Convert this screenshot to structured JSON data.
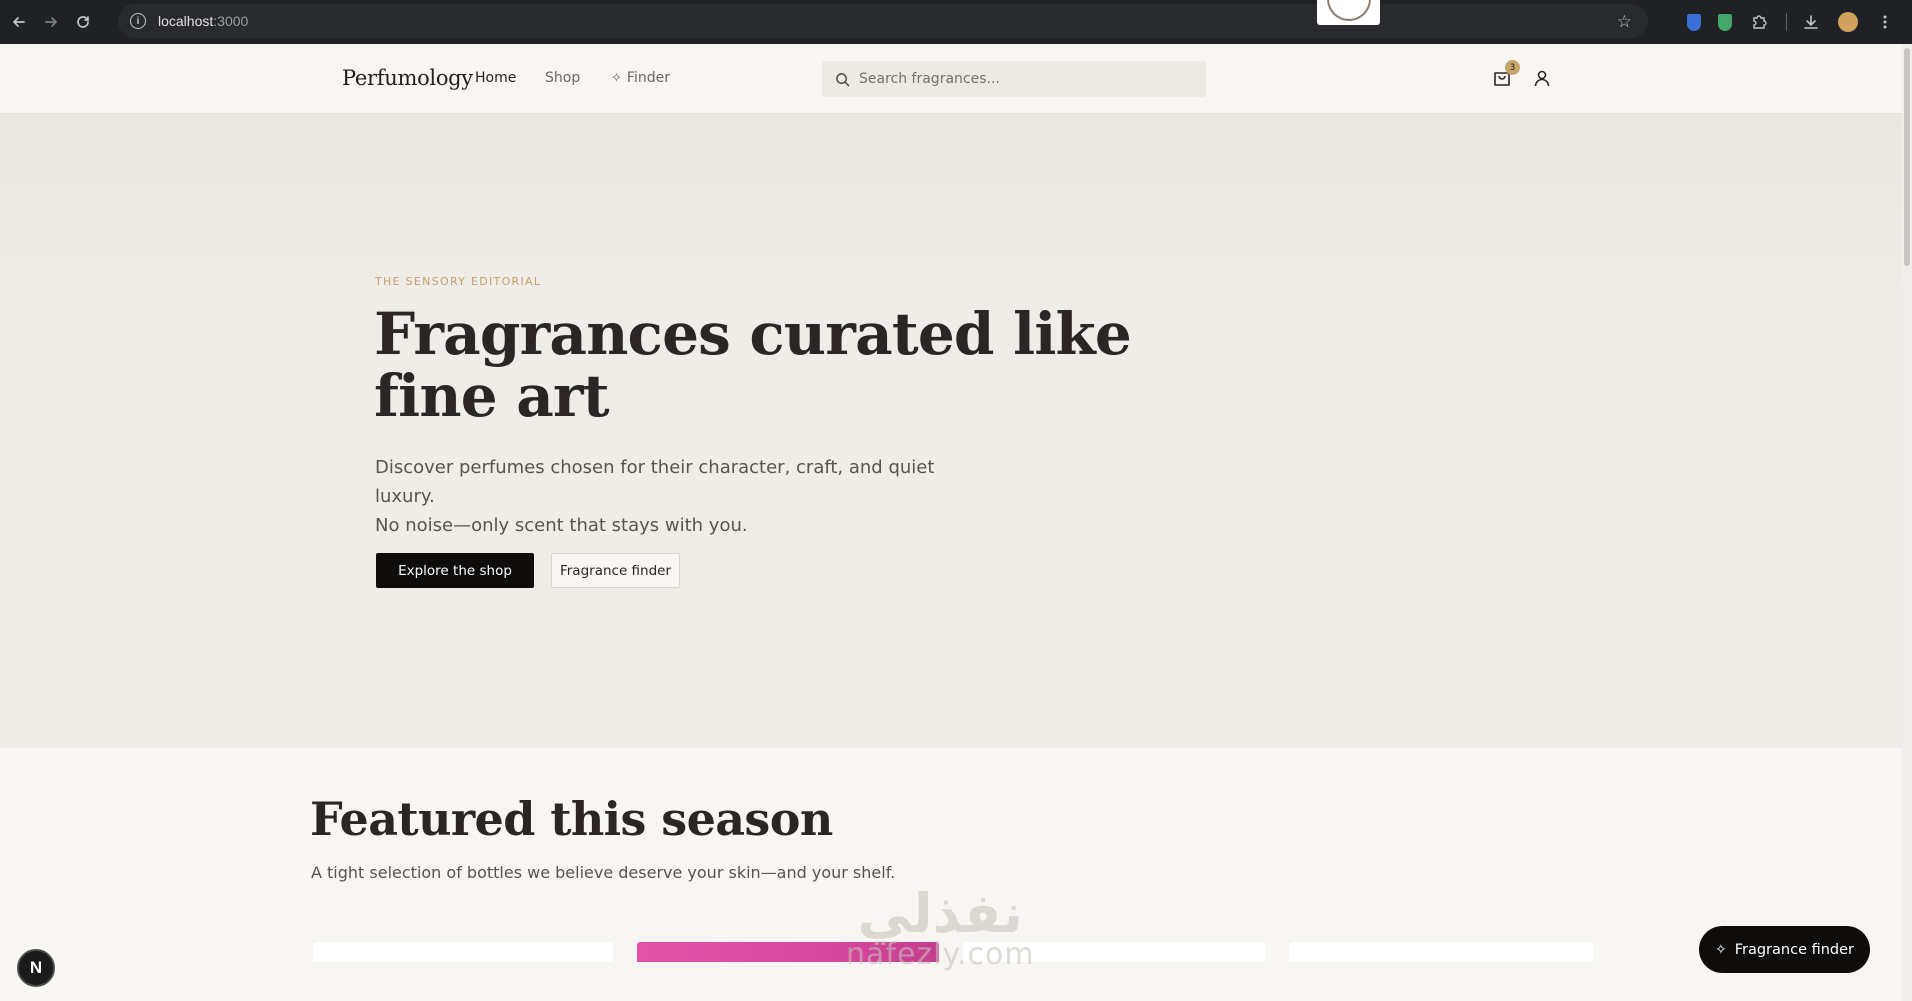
{
  "browser": {
    "url_host": "localhost",
    "url_port": ":3000"
  },
  "header": {
    "logo": "Perfumology",
    "nav": {
      "home": "Home",
      "shop": "Shop",
      "finder": "Finder"
    },
    "search_placeholder": "Search fragrances...",
    "cart_count": "3"
  },
  "hero": {
    "eyebrow": "THE SENSORY EDITORIAL",
    "title": "Fragrances curated like fine art",
    "subtitle_line1": "Discover perfumes chosen for their character, craft, and quiet luxury.",
    "subtitle_line2": "No noise—only scent that stays with you.",
    "primary_cta": "Explore the shop",
    "secondary_cta": "Fragrance finder"
  },
  "featured": {
    "title": "Featured this season",
    "subtitle": "A tight selection of bottles we believe deserve your skin—and your shelf."
  },
  "floating_button": "Fragrance finder",
  "dev_badge": "N",
  "watermark": {
    "arabic": "نفذلي",
    "latin": "nafezly.com"
  },
  "colors": {
    "accent_gold": "#c5a06d",
    "primary_button": "#0f0d0c",
    "hero_bg": "#f0ede8",
    "page_bg": "#f8f6f2"
  }
}
